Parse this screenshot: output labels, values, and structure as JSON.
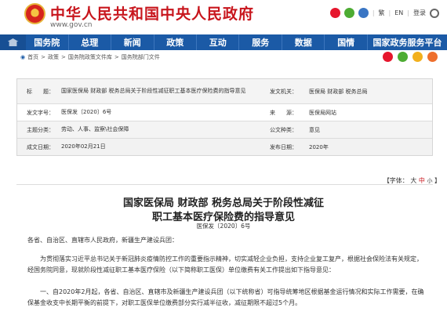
{
  "header": {
    "site_title": "中华人民共和国中央人民政府",
    "site_url": "www.gov.cn",
    "tools": [
      "繁",
      "EN",
      "登录"
    ]
  },
  "nav": {
    "items": [
      "国务院",
      "总理",
      "新闻",
      "政策",
      "互动",
      "服务",
      "数据",
      "国情"
    ],
    "wide_item": "国家政务服务平台"
  },
  "breadcrumb": {
    "items": [
      "首页",
      "政策",
      "国务院政策文件库",
      "国务院部门文件"
    ],
    "separator": ">"
  },
  "meta": {
    "index_label": "索 引 号：",
    "index_value": "",
    "topic_label": "主题分类：",
    "topic_value": "劳动、人事、监察\\社会保障",
    "title_label": "标　　题：",
    "title_value": "国家医保局 财政部 税务总局关于阶段性减征职工基本医疗保险费的指导意见",
    "issuer_label": "发文机关：",
    "issuer_value": "医保局 财政部 税务总局",
    "docno_label": "发文字号：",
    "docno_value": "医保发〔2020〕6号",
    "source_label": "来　　源：",
    "source_value": "医保局网站",
    "subject_label": "主题分类：",
    "subject_value": "劳动、人事、监察\\社会保障",
    "type_label": "公文种类：",
    "type_value": "意见",
    "date_label": "成文日期：",
    "date_value": "2020年02月21日",
    "pub_label": "发布日期：",
    "pub_value": "2020年"
  },
  "font_control": {
    "prefix": "【字体：",
    "big": "大",
    "mid": "中",
    "small": "小",
    "suffix": "】"
  },
  "document": {
    "title_line1": "国家医保局 财政部 税务总局关于阶段性减征",
    "title_line2": "职工基本医疗保险费的指导意见",
    "doc_number": "医保发〔2020〕6号",
    "salutation": "各省、自治区、直辖市人民政府，新疆生产建设兵团：",
    "paragraph1": "为贯彻落实习近平总书记关于新冠肺炎疫情防控工作的重要指示精神，切实减轻企业负担，支持企业复工复产，根据社会保险法有关规定，经国务院同意，现就阶段性减征职工基本医疗保险（以下简称职工医保）单位缴费有关工作提出如下指导意见：",
    "paragraph2": "一、自2020年2月起，各省、自治区、直辖市及新疆生产建设兵团（以下统称省）可指导统筹地区根据基金运行情况和实际工作需要，在确保基金收支中长期平衡的前提下，对职工医保单位缴费部分实行减半征收，减征期限不超过5个月。"
  }
}
